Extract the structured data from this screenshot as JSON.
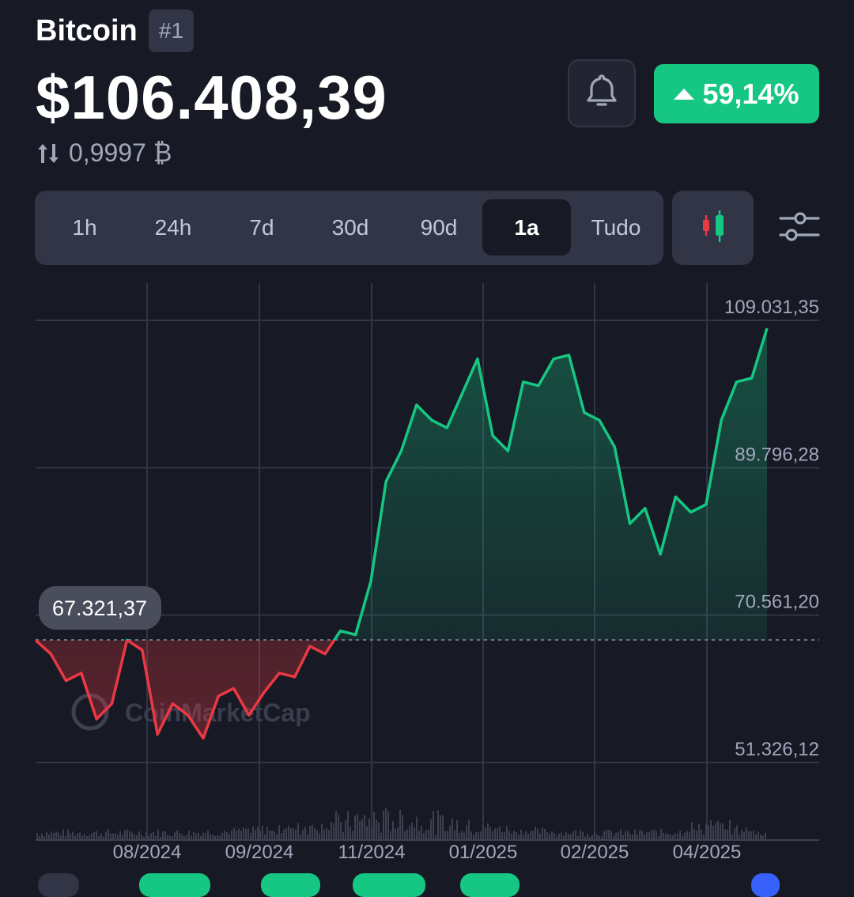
{
  "coin": {
    "name": "Bitcoin",
    "rank": "#1",
    "price": "$106.408,39",
    "btc_value": "0,9997 ₿",
    "change": "59,14%"
  },
  "colors": {
    "up": "#16c784",
    "down": "#ea3943",
    "background": "#171924",
    "panel": "#323546"
  },
  "icons": {
    "swap": "swap-arrows-icon",
    "bell": "bell-icon",
    "candle": "candlestick-icon",
    "settings": "sliders-icon"
  },
  "range_tabs": [
    "1h",
    "24h",
    "7d",
    "30d",
    "90d",
    "1a",
    "Tudo"
  ],
  "active_range": "1a",
  "watermark": "CoinMarketCap",
  "chart_data": {
    "type": "line",
    "x_ticks": [
      "08/2024",
      "09/2024",
      "11/2024",
      "01/2025",
      "02/2025",
      "04/2025"
    ],
    "y_ticks": [
      "109.031,35",
      "89.796,28",
      "70.561,20",
      "51.326,12"
    ],
    "ylim": [
      51326.12,
      109031.35
    ],
    "baseline": 67321.37,
    "baseline_label": "67.321,37",
    "grid": true,
    "x": [
      "2024-06",
      "2024-06",
      "2024-07",
      "2024-07",
      "2024-07",
      "2024-07",
      "2024-07",
      "2024-08",
      "2024-08",
      "2024-08",
      "2024-08",
      "2024-09",
      "2024-09",
      "2024-09",
      "2024-09",
      "2024-10",
      "2024-10",
      "2024-10",
      "2024-10",
      "2024-10",
      "2024-11",
      "2024-11",
      "2024-11",
      "2024-11",
      "2024-11",
      "2024-12",
      "2024-12",
      "2024-12",
      "2024-12",
      "2024-12",
      "2025-01",
      "2025-01",
      "2025-01",
      "2025-01",
      "2025-02",
      "2025-02",
      "2025-02",
      "2025-03",
      "2025-03",
      "2025-03",
      "2025-03",
      "2025-04",
      "2025-04",
      "2025-04",
      "2025-05",
      "2025-05",
      "2025-05"
    ],
    "values": [
      67300,
      65500,
      62000,
      63000,
      57000,
      59000,
      67300,
      66000,
      55000,
      59000,
      57500,
      54500,
      60000,
      61000,
      57500,
      60500,
      63000,
      62500,
      66500,
      65500,
      68500,
      68000,
      75000,
      88000,
      92000,
      98000,
      96000,
      95000,
      99500,
      104000,
      94000,
      92000,
      101000,
      100500,
      104000,
      104500,
      97000,
      96000,
      92500,
      82500,
      84500,
      78500,
      86000,
      84000,
      85000,
      96000,
      101000,
      101500,
      108000
    ]
  }
}
